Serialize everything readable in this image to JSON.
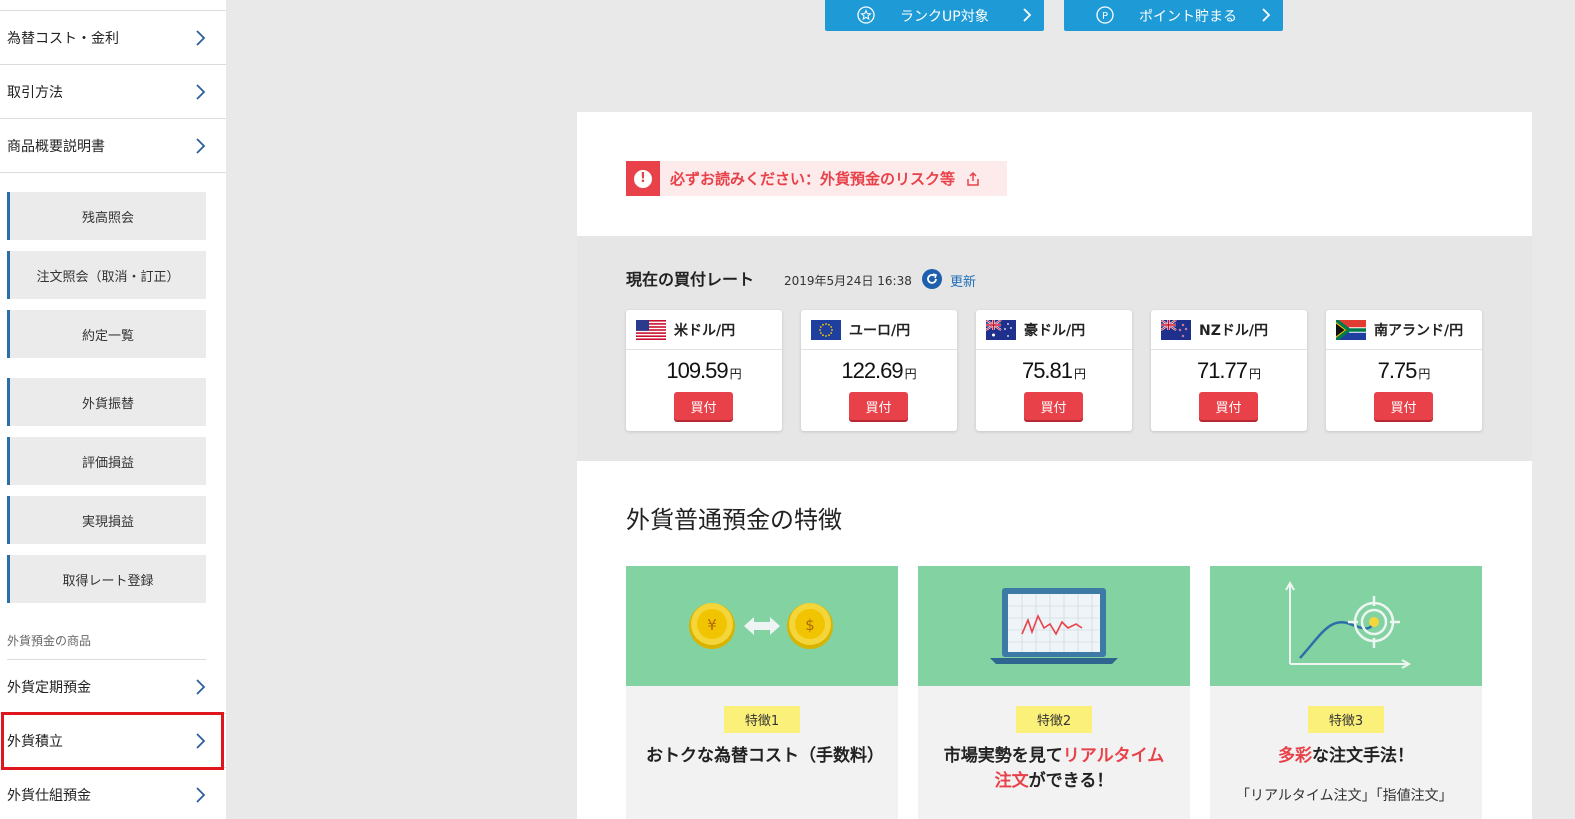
{
  "sidebar": {
    "links": [
      "為替コスト・金利",
      "取引方法",
      "商品概要説明書"
    ],
    "buttons": [
      "残高照会",
      "注文照会（取消・訂正）",
      "約定一覧",
      "外貨振替",
      "評価損益",
      "実現損益",
      "取得レート登録"
    ],
    "category_label": "外貨預金の商品",
    "products": [
      "外貨定期預金",
      "外貨積立",
      "外貨仕組預金"
    ]
  },
  "banners": {
    "rank": "ランクUP対象",
    "point": "ポイント貯まる"
  },
  "alert": {
    "text": "必ずお読みください：外貨預金のリスク等"
  },
  "rates": {
    "title": "現在の買付レート",
    "timestamp": "2019年5月24日 16:38",
    "refresh": "更新",
    "unit": "円",
    "buy_label": "買付",
    "items": [
      {
        "name": "米ドル/円",
        "price": "109.59"
      },
      {
        "name": "ユーロ/円",
        "price": "122.69"
      },
      {
        "name": "豪ドル/円",
        "price": "75.81"
      },
      {
        "name": "NZドル/円",
        "price": "71.77"
      },
      {
        "name": "南アランド/円",
        "price": "7.75"
      }
    ]
  },
  "features": {
    "heading": "外貨普通預金の特徴",
    "items": [
      {
        "tag": "特徴1",
        "title": "おトクな為替コスト（手数料）",
        "body": ""
      },
      {
        "tag": "特徴2",
        "title_pre": "市場実勢を見て",
        "title_red": "リアルタイム注文",
        "title_post": "ができる！",
        "body": ""
      },
      {
        "tag": "特徴3",
        "title_red": "多彩",
        "title_post": "な注文手法！",
        "body": "「リアルタイム注文」「指値注文」"
      }
    ]
  },
  "colors": {
    "accent_blue": "#1e9bd7",
    "alert_red": "#e8414a",
    "feature_green": "#82d2a2",
    "tag_yellow": "#fbf17a"
  }
}
